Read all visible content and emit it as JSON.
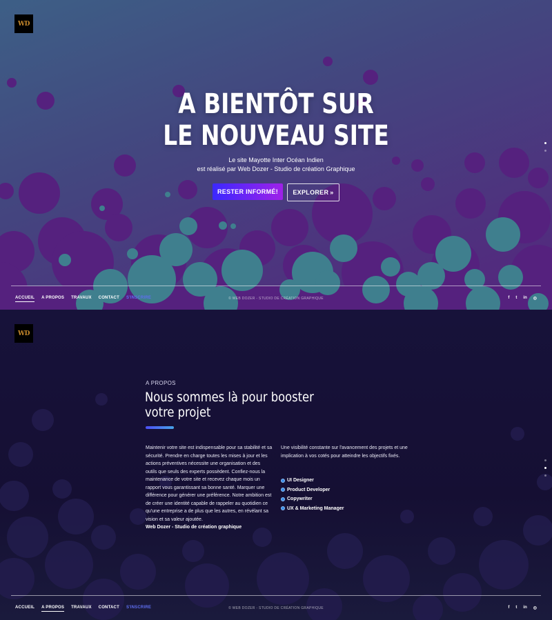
{
  "logo": {
    "text": "WD"
  },
  "hero": {
    "title_line1": "A BIENTÔT SUR",
    "title_line2": "LE NOUVEAU SITE",
    "subtitle_line1": "Le site Mayotte Inter Océan Indien",
    "subtitle_line2": "est réalisé par Web Dozer - Studio de création Graphique",
    "primary_button": "RESTER INFORMÉ!",
    "secondary_button": "EXPLORER",
    "secondary_button_icon": "»"
  },
  "nav": {
    "items": [
      "ACCUEIL",
      "A PROPOS",
      "TRAVAUX",
      "CONTACT",
      "S'INSCRIRE"
    ]
  },
  "footer": {
    "copyright": "© WEB DOZER - STUDIO DE CRÉATION GRAPHIQUE",
    "social": [
      "f",
      "t",
      "in",
      "◎"
    ],
    "social_icons": [
      "facebook-icon",
      "twitter-icon",
      "linkedin-icon",
      "instagram-icon"
    ]
  },
  "about": {
    "kicker": "A PROPOS",
    "title_line1": "Nous sommes là pour booster",
    "title_line2": "votre projet",
    "left_text": "Maintenir votre site est indispensable pour sa stabilité et sa sécurité. Prendre en charge toutes les mises à jour et les actions préventives nécessite une organisation et des outils que seuls des experts possèdent. Confiez-nous la maintenance de votre site et recevez chaque mois un rapport vous garantissant sa bonne santé. Marquer une différence pour générer une préférence. Notre ambition est de créer une identité capable de rappeler au quotidien ce qu'une entreprise a de plus que les autres, en révélant sa vision et sa valeur ajoutée.",
    "signature": "Web Dozer - Studio de création graphique",
    "right_text": "Une visibilité constante sur l'avancement des projets et une implication à vos cotés pour atteindre les objectifs fixés.",
    "skills": [
      "UI Designer",
      "Product Developer",
      "Copywriter",
      "UX & Marketing Manager"
    ]
  },
  "colors": {
    "accent_gradient_start": "#3b28ff",
    "accent_gradient_end": "#9f21e8",
    "nav_accent": "#5f6ef0",
    "bubble_purple": "#55217e",
    "bubble_teal": "#3f7f8e",
    "about_background": "#17123a"
  }
}
